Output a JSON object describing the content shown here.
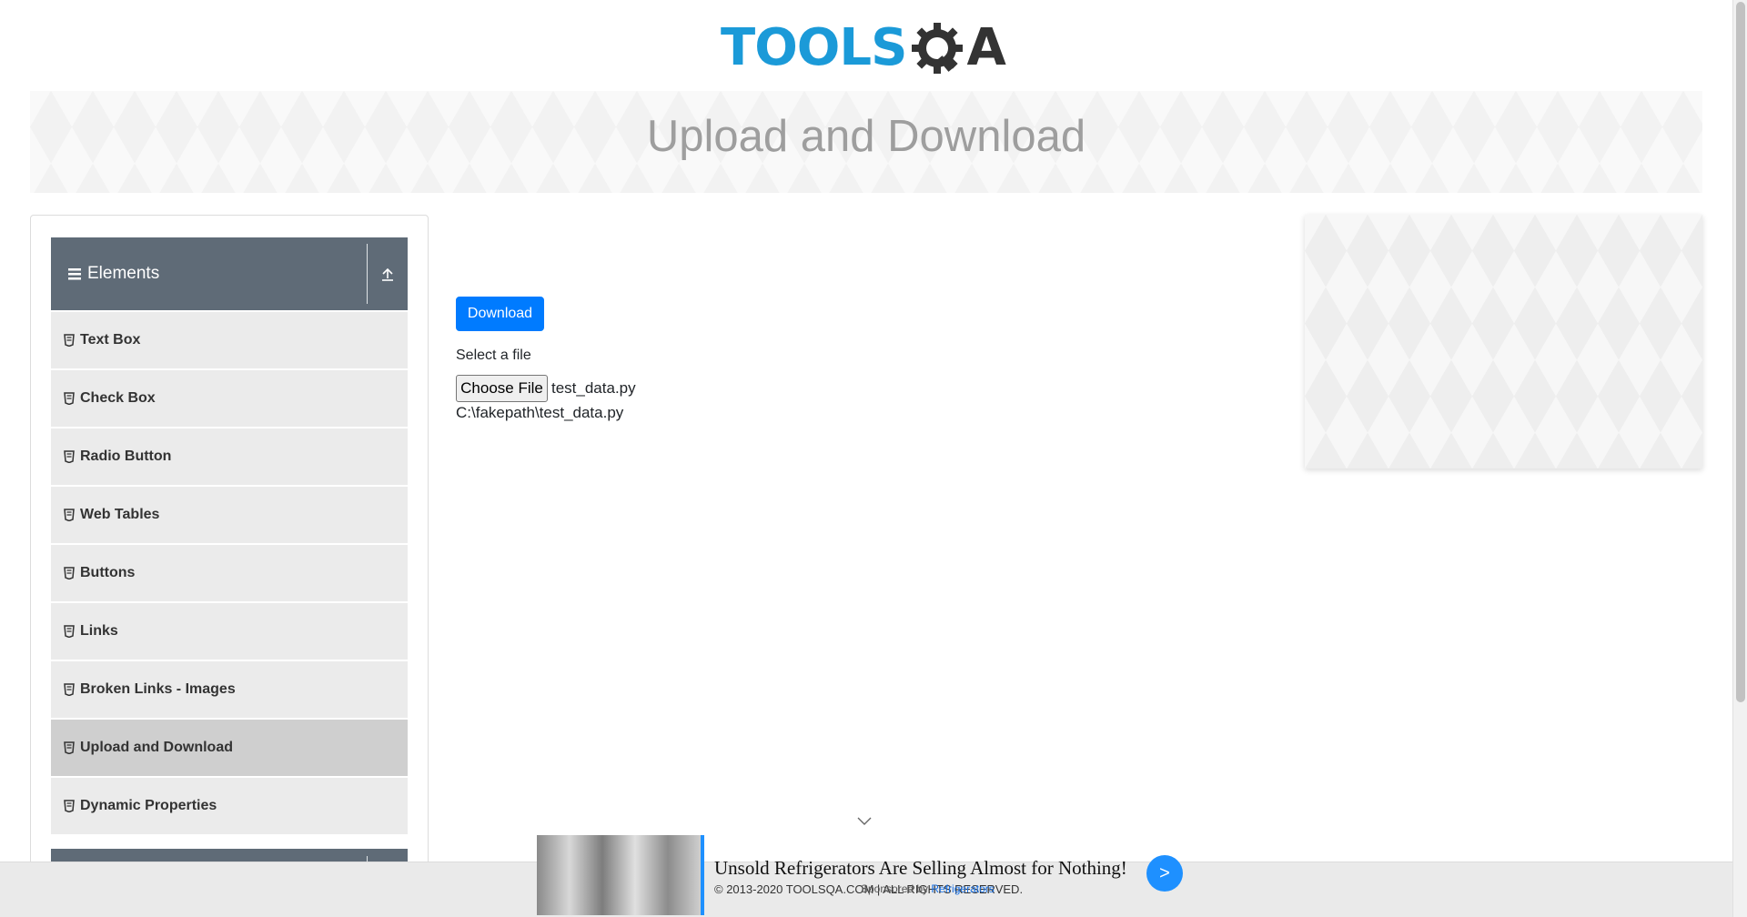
{
  "logo": {
    "text_tools": "TOOLS",
    "text_a": "A"
  },
  "banner": {
    "title": "Upload and Download"
  },
  "sidebar": {
    "group_title": "Elements",
    "items": [
      {
        "label": "Text Box"
      },
      {
        "label": "Check Box"
      },
      {
        "label": "Radio Button"
      },
      {
        "label": "Web Tables"
      },
      {
        "label": "Buttons"
      },
      {
        "label": "Links"
      },
      {
        "label": "Broken Links - Images"
      },
      {
        "label": "Upload and Download"
      },
      {
        "label": "Dynamic Properties"
      }
    ]
  },
  "main": {
    "download_label": "Download",
    "select_label": "Select a file",
    "choose_file_label": "Choose File",
    "chosen_file": "test_data.py",
    "uploaded_path": "C:\\fakepath\\test_data.py"
  },
  "footer": {
    "copyright": "© 2013-2020 TOOLSQA.COM | ALL RIGHTS RESERVED."
  },
  "ad": {
    "headline": "Unsold Refrigerators Are Selling Almost for Nothing!",
    "sponsored_prefix": "Sponsored by ",
    "sponsor": "Refrigerators",
    "go_label": ">"
  },
  "colors": {
    "primary": "#007bff",
    "sidebar_header": "#5f6b77",
    "logo_blue": "#1b9ad8"
  },
  "icons": [
    "menu-icon",
    "collapse-icon",
    "item-icon",
    "chevron-down-icon",
    "gear-icon"
  ]
}
